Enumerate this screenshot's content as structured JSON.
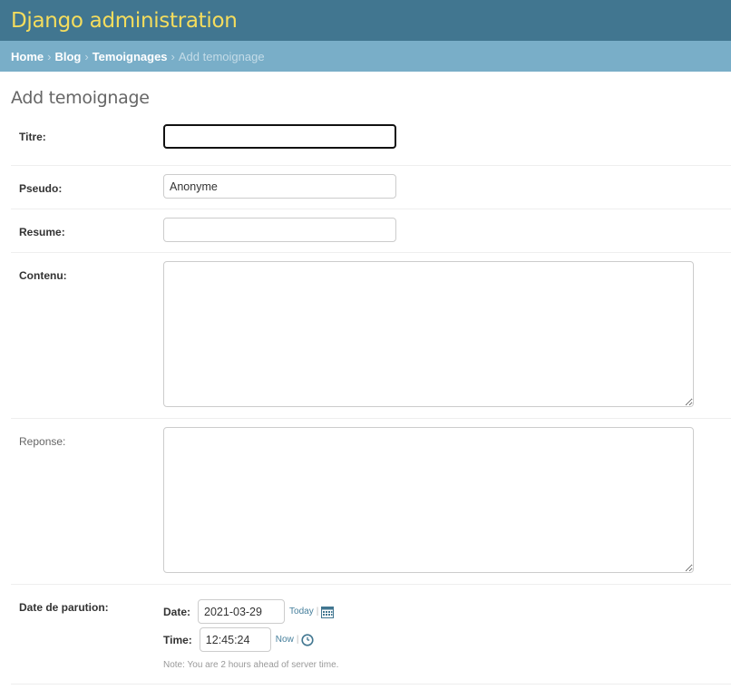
{
  "header": {
    "site_name": "Django administration"
  },
  "breadcrumbs": {
    "home": "Home",
    "blog": "Blog",
    "temoignages": "Temoignages",
    "current": "Add temoignage",
    "separator": "›"
  },
  "page": {
    "title": "Add temoignage"
  },
  "form": {
    "titre": {
      "label": "Titre:",
      "value": ""
    },
    "pseudo": {
      "label": "Pseudo:",
      "value": "Anonyme"
    },
    "resume": {
      "label": "Resume:",
      "value": ""
    },
    "contenu": {
      "label": "Contenu:",
      "value": ""
    },
    "reponse": {
      "label": "Reponse:",
      "value": ""
    },
    "date_parution": {
      "label": "Date de parution:",
      "date_label": "Date:",
      "date_value": "2021-03-29",
      "today_label": "Today",
      "time_label": "Time:",
      "time_value": "12:45:24",
      "now_label": "Now",
      "separator": "|",
      "help_text": "Note: You are 2 hours ahead of server time."
    }
  },
  "icons": {
    "calendar": "calendar-icon",
    "clock": "clock-icon"
  },
  "colors": {
    "header_bg": "#417690",
    "site_name": "#f5dd5d",
    "breadcrumbs_bg": "#79aec8",
    "link": "#447e9b"
  }
}
